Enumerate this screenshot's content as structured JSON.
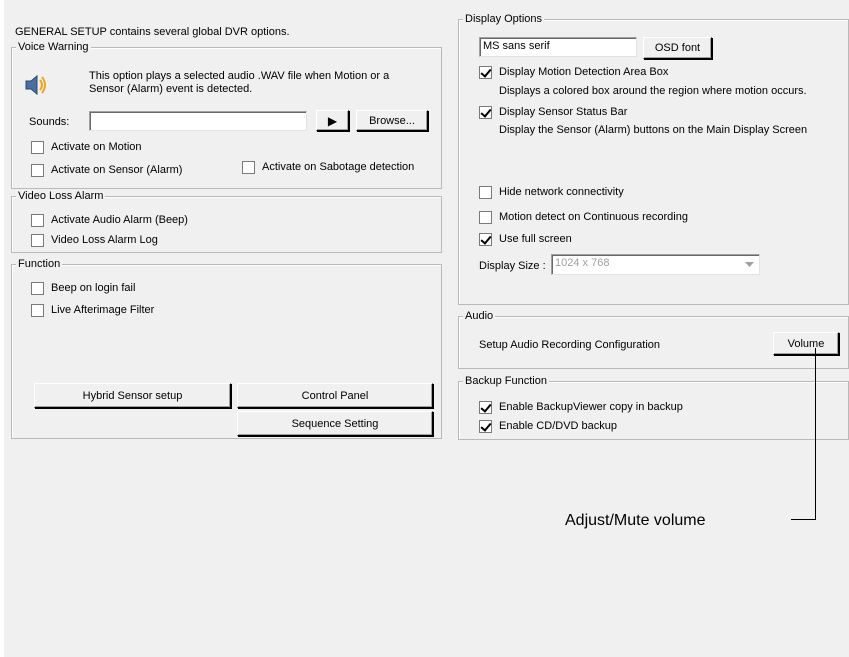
{
  "intro_text": "GENERAL SETUP contains several global DVR options.",
  "voice_warning": {
    "legend": "Voice Warning",
    "description_line1": "This option plays a selected audio .WAV file when Motion or a",
    "description_line2": "Sensor (Alarm) event is detected.",
    "sounds_label": "Sounds:",
    "sounds_value": "",
    "play_glyph": "▶",
    "browse_label": "Browse...",
    "activate_motion": "Activate on Motion",
    "activate_sensor": "Activate on Sensor (Alarm)",
    "activate_sabotage": "Activate on Sabotage detection",
    "icon": "speaker-icon"
  },
  "video_loss": {
    "legend": "Video Loss Alarm",
    "audio_alarm": "Activate Audio Alarm (Beep)",
    "alarm_log": "Video Loss Alarm Log"
  },
  "function": {
    "legend": "Function",
    "beep_login": "Beep on login fail",
    "afterimage": "Live Afterimage Filter",
    "hybrid_button": "Hybrid Sensor setup",
    "control_panel_button": "Control Panel",
    "sequence_button": "Sequence Setting"
  },
  "display_options": {
    "legend": "Display Options",
    "font_value": "MS sans serif",
    "osd_font_button": "OSD font",
    "motion_area_label": "Display Motion Detection Area Box",
    "motion_area_desc": "Displays a colored box around the region where motion occurs.",
    "sensor_bar_label": "Display Sensor Status Bar",
    "sensor_bar_desc": "Display the Sensor (Alarm) buttons on the Main Display Screen",
    "hide_network": "Hide network connectivity",
    "motion_continuous": "Motion detect on Continuous recording",
    "full_screen": "Use full screen",
    "display_size_label": "Display Size :",
    "display_size_value": "1024 x 768"
  },
  "audio": {
    "legend": "Audio",
    "setup_text": "Setup Audio Recording Configuration",
    "volume_button": "Volume"
  },
  "backup": {
    "legend": "Backup Function",
    "backup_viewer": "Enable BackupViewer copy in backup",
    "cd_dvd": "Enable CD/DVD backup"
  },
  "callout": {
    "text": "Adjust/Mute volume"
  }
}
